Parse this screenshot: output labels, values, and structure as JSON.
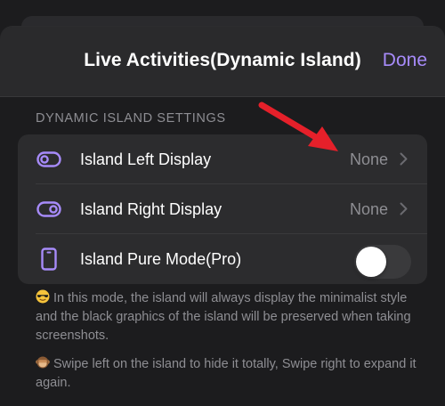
{
  "header": {
    "title": "Live Activities(Dynamic Island)",
    "done_label": "Done"
  },
  "section": {
    "header": "DYNAMIC ISLAND SETTINGS"
  },
  "rows": [
    {
      "label": "Island Left Display",
      "value": "None",
      "icon": "toggle-left-icon"
    },
    {
      "label": "Island Right Display",
      "value": "None",
      "icon": "toggle-right-icon"
    },
    {
      "label": "Island Pure Mode(Pro)",
      "icon": "phone-icon",
      "toggle_on": false
    }
  ],
  "notes": {
    "pure_mode": "In this mode, the island will always display the minimalist style and the black graphics of the island will be preserved when taking screenshots.",
    "swipe": "Swipe left on the island to hide it totally, Swipe right to expand it again."
  },
  "colors": {
    "accent": "#a78bfa",
    "annotation_arrow": "#e5202a"
  }
}
